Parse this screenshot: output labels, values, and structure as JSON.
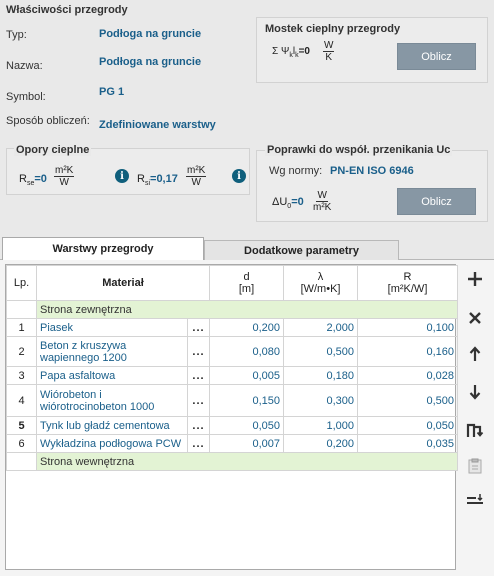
{
  "header": {
    "title": "Właściwości przegrody"
  },
  "props": {
    "typ_label": "Typ:",
    "typ_value": "Podłoga na gruncie",
    "nazwa_label": "Nazwa:",
    "nazwa_value": "Podłoga na gruncie",
    "symbol_label": "Symbol:",
    "symbol_value": "PG 1",
    "sposob_label": "Sposób obliczeń:",
    "sposob_value": "Zdefiniowane warstwy"
  },
  "mostek": {
    "title": "Mostek cieplny przegrody",
    "formula_prefix": "Σ Ψ",
    "formula_sub": "k",
    "formula_mid": "l",
    "formula_sub2": "k",
    "formula_eq": "=0",
    "unit_num": "W",
    "unit_den": "K",
    "button": "Oblicz"
  },
  "opory": {
    "title": "Opory cieplne",
    "rse_label": "R",
    "rse_sub": "se",
    "rse_eq": "=0",
    "rsi_label": "R",
    "rsi_sub": "si",
    "rsi_eq": "=0,17",
    "unit_num": "m²K",
    "unit_den": "W",
    "info": "i"
  },
  "poprawki": {
    "title": "Poprawki do współ. przenikania Uc",
    "norm_label": "Wg normy:",
    "norm_value": "PN-EN ISO 6946",
    "du_label": "ΔU",
    "du_sub": "0",
    "du_eq": "=0",
    "unit_num": "W",
    "unit_den": "m²K",
    "button": "Oblicz"
  },
  "tabs": [
    {
      "label": "Warstwy przegrody",
      "active": true
    },
    {
      "label": "Dodatkowe parametry",
      "active": false
    }
  ],
  "table": {
    "headers": {
      "lp": "Lp.",
      "material": "Materiał",
      "d": "d",
      "d_unit": "[m]",
      "lambda": "λ",
      "lambda_unit": "[W/m•K]",
      "r": "R",
      "r_unit": "[m²K/W]"
    },
    "section_top": "Strona zewnętrzna",
    "section_bottom": "Strona wewnętrzna",
    "dots": "...",
    "rows": [
      {
        "lp": "1",
        "material": "Piasek",
        "d": "0,200",
        "lambda": "2,000",
        "r": "0,100"
      },
      {
        "lp": "2",
        "material": "Beton z kruszywa wapiennego 1200",
        "d": "0,080",
        "lambda": "0,500",
        "r": "0,160"
      },
      {
        "lp": "3",
        "material": "Papa asfaltowa",
        "d": "0,005",
        "lambda": "0,180",
        "r": "0,028"
      },
      {
        "lp": "4",
        "material": "Wiórobeton i wiórotrocinobeton 1000",
        "d": "0,150",
        "lambda": "0,300",
        "r": "0,500"
      },
      {
        "lp": "5",
        "material": "Tynk lub gładź cementowa",
        "d": "0,050",
        "lambda": "1,000",
        "r": "0,050"
      },
      {
        "lp": "6",
        "material": "Wykładzina podłogowa PCW",
        "d": "0,007",
        "lambda": "0,200",
        "r": "0,035"
      }
    ]
  },
  "toolbar": [
    "plus-icon",
    "close-icon",
    "arrow-up-icon",
    "arrow-down-icon",
    "split-icon",
    "paste-icon",
    "sort-icon"
  ]
}
